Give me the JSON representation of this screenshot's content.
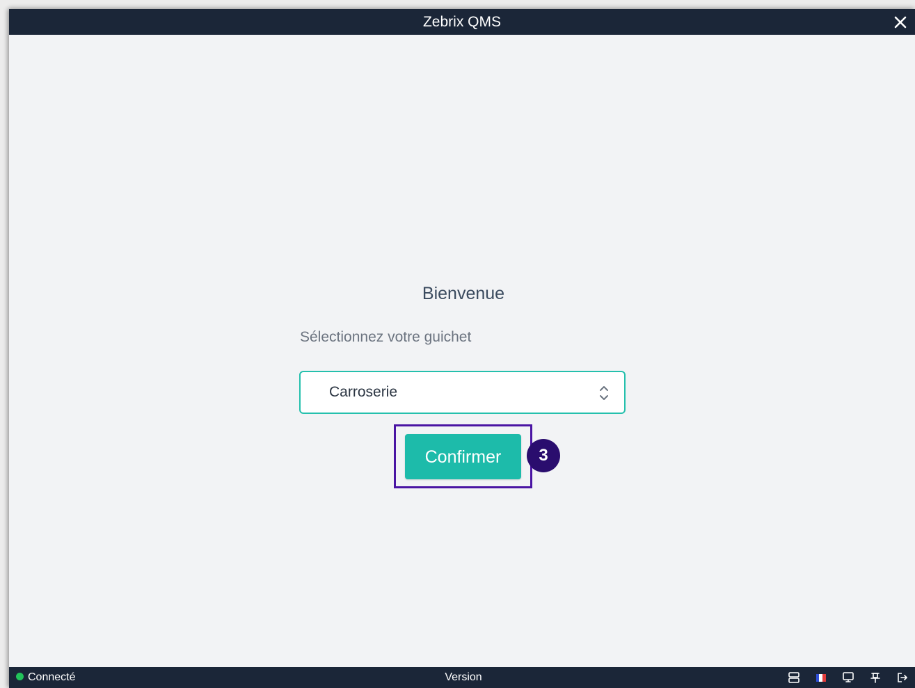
{
  "window": {
    "title": "Zebrix QMS"
  },
  "main": {
    "welcome": "Bienvenue",
    "select_label": "Sélectionnez votre guichet",
    "select_value": "Carroserie",
    "confirm_label": "Confirmer",
    "step_badge": "3"
  },
  "statusbar": {
    "status_text": "Connecté",
    "status_color": "#22c35a",
    "center_text": "Version",
    "icons": [
      "server-icon",
      "french-flag-icon",
      "monitor-icon",
      "pin-icon",
      "logout-icon"
    ]
  },
  "colors": {
    "titlebar": "#1b2638",
    "accent": "#1dbbaa",
    "highlight": "#4a14a3",
    "badge": "#2a0d6e"
  }
}
